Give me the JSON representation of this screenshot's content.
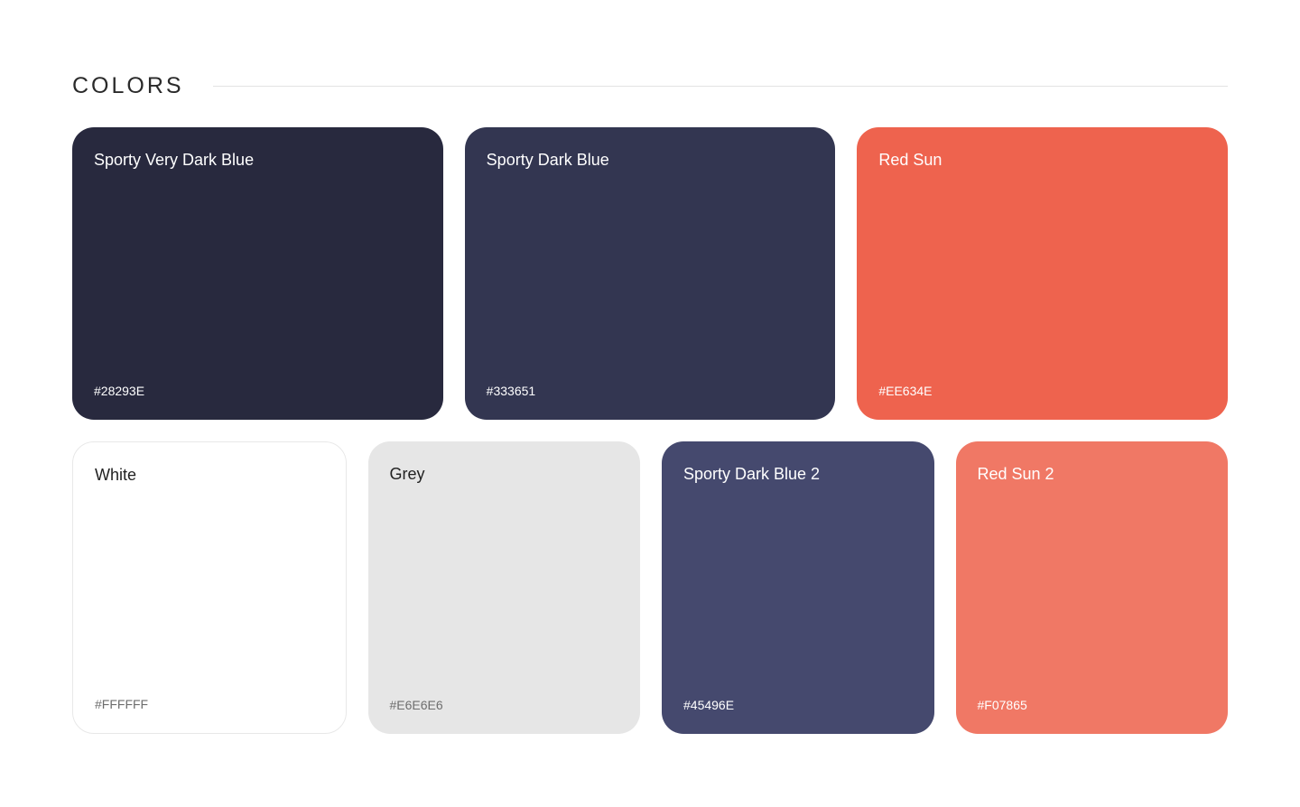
{
  "section": {
    "title": "COLORS"
  },
  "palette": {
    "row1": [
      {
        "name": "Sporty Very Dark Blue",
        "hex": "#28293E",
        "color": "#28293E",
        "text_tone": "dark"
      },
      {
        "name": "Sporty Dark Blue",
        "hex": "#333651",
        "color": "#333651",
        "text_tone": "dark"
      },
      {
        "name": "Red Sun",
        "hex": "#EE634E",
        "color": "#EE634E",
        "text_tone": "dark"
      }
    ],
    "row2": [
      {
        "name": "White",
        "hex": "#FFFFFF",
        "color": "#FFFFFF",
        "text_tone": "light"
      },
      {
        "name": "Grey",
        "hex": "#E6E6E6",
        "color": "#E6E6E6",
        "text_tone": "light"
      },
      {
        "name": "Sporty Dark Blue 2",
        "hex": "#45496E",
        "color": "#45496E",
        "text_tone": "dark"
      },
      {
        "name": "Red Sun 2",
        "hex": "#F07865",
        "color": "#F07865",
        "text_tone": "dark"
      }
    ]
  }
}
